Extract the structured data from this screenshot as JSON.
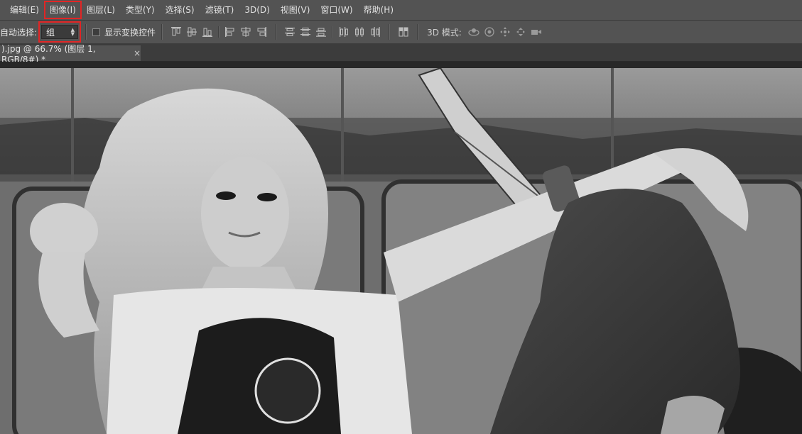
{
  "menu": [
    {
      "label": "编辑(E)",
      "highlighted": false
    },
    {
      "label": "图像(I)",
      "highlighted": true
    },
    {
      "label": "图层(L)",
      "highlighted": false
    },
    {
      "label": "类型(Y)",
      "highlighted": false
    },
    {
      "label": "选择(S)",
      "highlighted": false
    },
    {
      "label": "滤镜(T)",
      "highlighted": false
    },
    {
      "label": "3D(D)",
      "highlighted": false
    },
    {
      "label": "视图(V)",
      "highlighted": false
    },
    {
      "label": "窗口(W)",
      "highlighted": false
    },
    {
      "label": "帮助(H)",
      "highlighted": false
    }
  ],
  "options": {
    "auto_select_label": "自动选择:",
    "auto_select_value": "组",
    "show_transform_label": "显示变换控件",
    "mode_3d_label": "3D 模式:",
    "highlight_color": "#e12525"
  },
  "document": {
    "tab_title": ").jpg @ 66.7% (图层 1, RGB/8#) *",
    "close_glyph": "×"
  },
  "canvas": {
    "content": "grayscale photograph of a woman with long light hair sitting on a sofa beside an electric guitar, in front of a weathered wall"
  },
  "icons": {
    "align": [
      "align-top-edges-icon",
      "align-vertical-centers-icon",
      "align-bottom-edges-icon",
      "align-left-edges-icon",
      "align-horizontal-centers-icon",
      "align-right-edges-icon"
    ],
    "distribute": [
      "distribute-top-icon",
      "distribute-vcenter-icon",
      "distribute-bottom-icon",
      "distribute-left-icon",
      "distribute-hcenter-icon",
      "distribute-right-icon"
    ],
    "auto_align": "auto-align-layers-icon",
    "mode_3d": [
      "orbit-3d-icon",
      "roll-3d-icon",
      "pan-3d-icon",
      "slide-3d-icon",
      "scale-3d-icon"
    ]
  }
}
